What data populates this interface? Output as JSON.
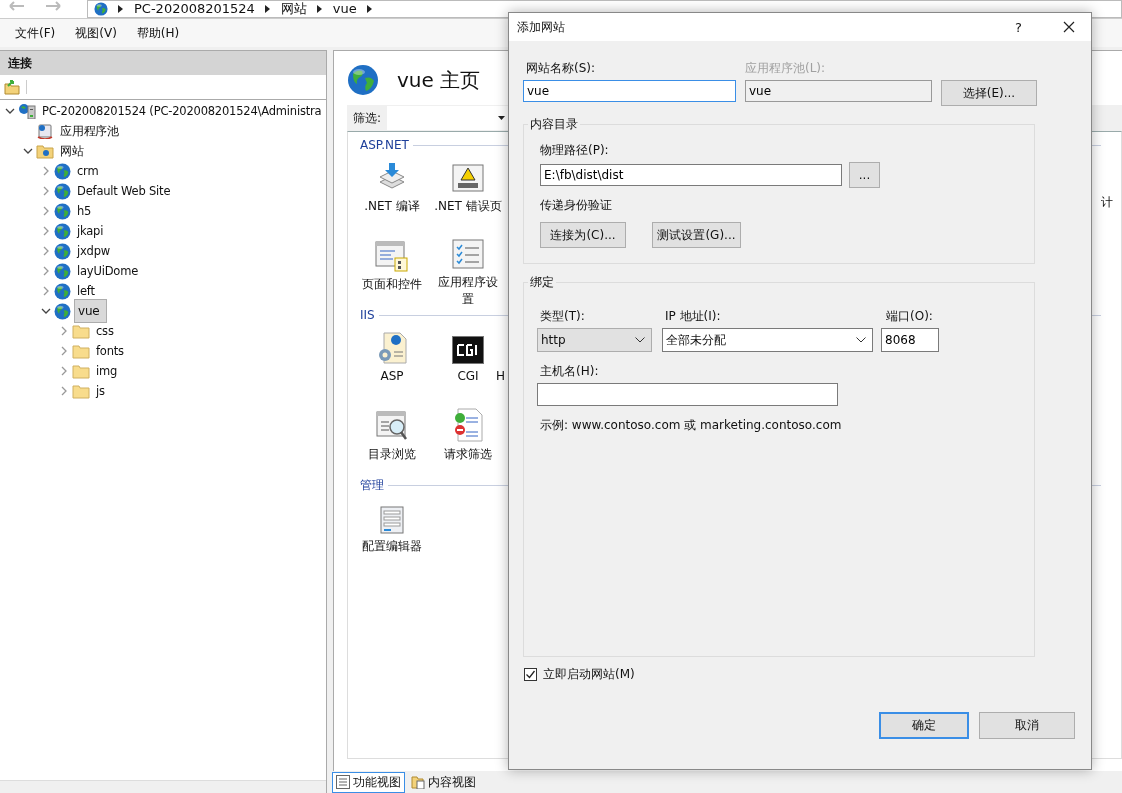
{
  "address_bar": {
    "crumbs": [
      "PC-202008201524",
      "网站",
      "vue"
    ]
  },
  "menu": [
    {
      "label": "文件(F)"
    },
    {
      "label": "视图(V)"
    },
    {
      "label": "帮助(H)"
    }
  ],
  "connections": {
    "title": "连接",
    "tree": [
      {
        "label": "PC-202008201524 (PC-202008201524\\Administra",
        "kind": "server",
        "expanded": true,
        "selected": false,
        "children": [
          {
            "label": "应用程序池",
            "kind": "pools",
            "selected": false
          },
          {
            "label": "网站",
            "kind": "sites",
            "expanded": true,
            "selected": false,
            "children": [
              {
                "label": "crm",
                "kind": "site",
                "expanded": false,
                "selected": false
              },
              {
                "label": "Default Web Site",
                "kind": "site",
                "expanded": false,
                "selected": false
              },
              {
                "label": "h5",
                "kind": "site",
                "expanded": false,
                "selected": false
              },
              {
                "label": "jkapi",
                "kind": "site",
                "expanded": false,
                "selected": false
              },
              {
                "label": "jxdpw",
                "kind": "site",
                "expanded": false,
                "selected": false
              },
              {
                "label": "layUiDome",
                "kind": "site",
                "expanded": false,
                "selected": false
              },
              {
                "label": "left",
                "kind": "site",
                "expanded": false,
                "selected": false
              },
              {
                "label": "vue",
                "kind": "site",
                "expanded": true,
                "selected": true,
                "children": [
                  {
                    "label": "css",
                    "kind": "folder",
                    "expanded": false,
                    "selected": false
                  },
                  {
                    "label": "fonts",
                    "kind": "folder",
                    "expanded": false,
                    "selected": false
                  },
                  {
                    "label": "img",
                    "kind": "folder",
                    "expanded": false,
                    "selected": false
                  },
                  {
                    "label": "js",
                    "kind": "folder",
                    "expanded": false,
                    "selected": false
                  }
                ]
              }
            ]
          }
        ]
      }
    ]
  },
  "home": {
    "title": "vue 主页",
    "filter_label": "筛选:",
    "edge_label": "计",
    "groups": [
      {
        "title": "ASP.NET",
        "rows": [
          [
            {
              "label": ".NET 编译"
            },
            {
              "label": ".NET 错误页"
            }
          ],
          [
            {
              "label": "页面和控件"
            },
            {
              "label": "应用程序设置"
            }
          ]
        ]
      },
      {
        "title": "IIS",
        "rows": [
          [
            {
              "label": "ASP"
            },
            {
              "label": "CGI"
            },
            {
              "label": "H"
            }
          ],
          [
            {
              "label": "目录浏览"
            },
            {
              "label": "请求筛选"
            }
          ]
        ]
      },
      {
        "title": "管理",
        "rows": [
          [
            {
              "label": "配置编辑器"
            }
          ]
        ]
      }
    ]
  },
  "view_tabs": [
    {
      "label": "功能视图",
      "selected": true
    },
    {
      "label": "内容视图",
      "selected": false
    }
  ],
  "dialog": {
    "title": "添加网站",
    "help": "?",
    "site_name": {
      "label": "网站名称(S):",
      "value": "vue"
    },
    "app_pool": {
      "label": "应用程序池(L):",
      "value": "vue",
      "disabled": true
    },
    "select_button": "选择(E)...",
    "content_dir": {
      "legend": "内容目录",
      "path_label": "物理路径(P):",
      "path": "E:\\fb\\dist\\dist",
      "browse_button": "...",
      "auth_label": "传递身份验证",
      "connect_button": "连接为(C)...",
      "test_button": "测试设置(G)..."
    },
    "binding": {
      "legend": "绑定",
      "type_label": "类型(T):",
      "type": "http",
      "ip_label": "IP 地址(I):",
      "ip": "全部未分配",
      "port_label": "端口(O):",
      "port": "8068",
      "host_label": "主机名(H):",
      "example": "示例: www.contoso.com 或 marketing.contoso.com"
    },
    "start_now": {
      "label": "立即启动网站(M)",
      "checked": true
    },
    "ok_button": "确定",
    "cancel_button": "取消"
  }
}
